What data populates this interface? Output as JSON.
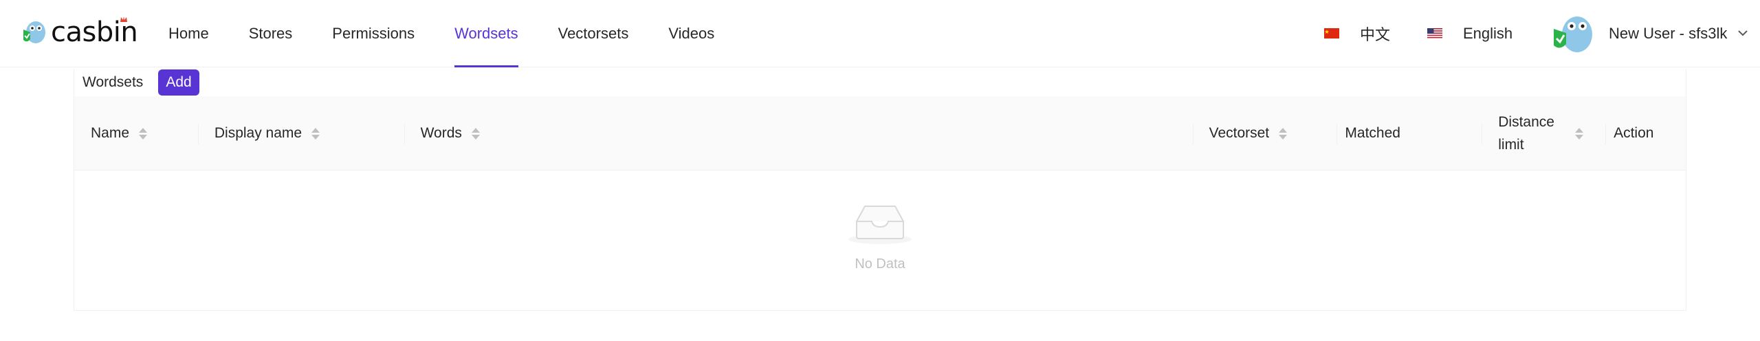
{
  "brand": {
    "name": "casbin",
    "accent": "#5734d3"
  },
  "nav": {
    "items": [
      {
        "label": "Home",
        "active": false
      },
      {
        "label": "Stores",
        "active": false
      },
      {
        "label": "Permissions",
        "active": false
      },
      {
        "label": "Wordsets",
        "active": true
      },
      {
        "label": "Vectorsets",
        "active": false
      },
      {
        "label": "Videos",
        "active": false
      }
    ]
  },
  "languages": {
    "zh": {
      "label": "中文",
      "flag": "china-flag-icon"
    },
    "en": {
      "label": "English",
      "flag": "us-flag-icon"
    }
  },
  "user": {
    "name": "New User - sfs3lk"
  },
  "card": {
    "title": "Wordsets",
    "add_label": "Add"
  },
  "table": {
    "columns": [
      {
        "label": "Name",
        "sortable": true
      },
      {
        "label": "Display name",
        "sortable": true
      },
      {
        "label": "Words",
        "sortable": true
      },
      {
        "label": "Vectorset",
        "sortable": true
      },
      {
        "label": "Matched",
        "sortable": false
      },
      {
        "label": "Distance limit",
        "sortable": true
      },
      {
        "label": "Action",
        "sortable": false
      }
    ],
    "empty_text": "No Data"
  }
}
